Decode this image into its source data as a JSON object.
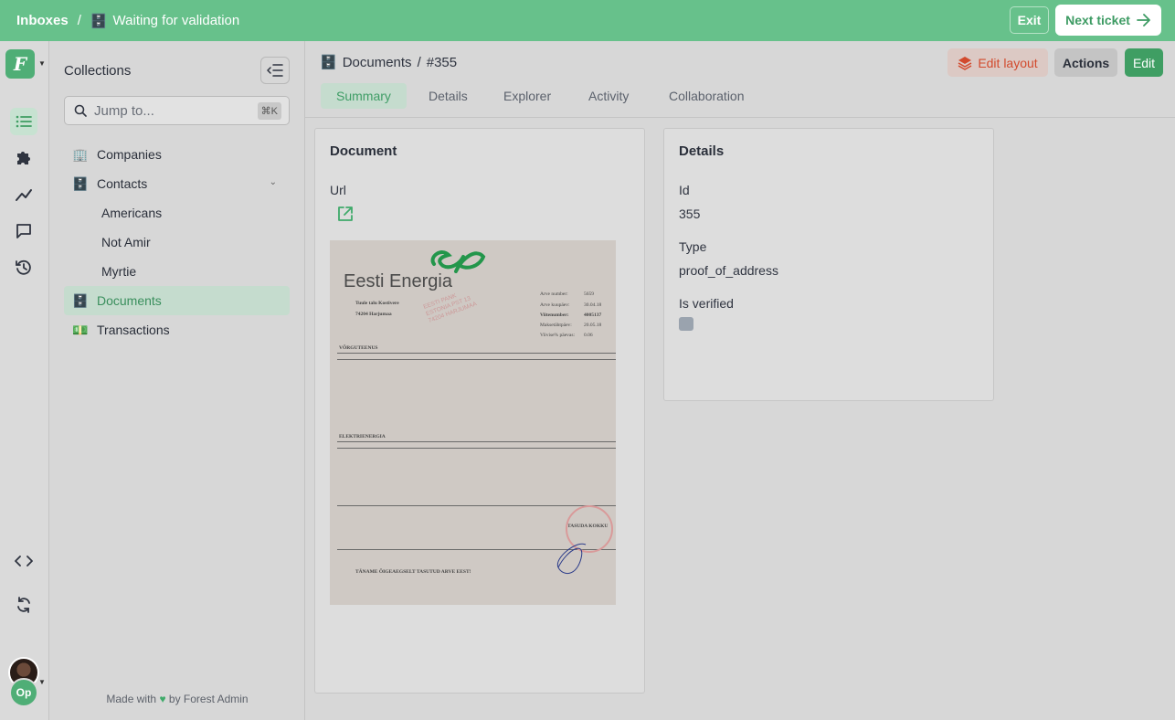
{
  "topbar": {
    "root": "Inboxes",
    "separator": "/",
    "current_icon": "🗄️",
    "current": "Waiting for validation",
    "exit_label": "Exit",
    "next_label": "Next ticket"
  },
  "rail": {
    "icons": [
      "list-icon",
      "puzzle-icon",
      "chart-line-icon",
      "chat-icon",
      "history-icon",
      "code-icon",
      "sync-icon"
    ],
    "user_initials": "Op"
  },
  "sidebar": {
    "title": "Collections",
    "search_placeholder": "Jump to...",
    "search_shortcut": "⌘K",
    "items": [
      {
        "icon": "🏢",
        "label": "Companies"
      },
      {
        "icon": "🗄️",
        "label": "Contacts"
      },
      {
        "label": "Americans"
      },
      {
        "label": "Not Amir"
      },
      {
        "label": "Myrtie"
      },
      {
        "icon": "🗄️",
        "label": "Documents"
      },
      {
        "icon": "💵",
        "label": "Transactions"
      }
    ],
    "footer_prefix": "Made with",
    "footer_suffix": "by Forest Admin"
  },
  "header": {
    "title_icon": "🗄️",
    "collection": "Documents",
    "separator": "/",
    "record": "#355",
    "tabs": [
      "Summary",
      "Details",
      "Explorer",
      "Activity",
      "Collaboration"
    ],
    "active_tab": "Summary",
    "edit_layout_label": "Edit layout",
    "actions_label": "Actions",
    "edit_label": "Edit"
  },
  "document_card": {
    "title": "Document",
    "url_label": "Url",
    "image": {
      "brand": "Eesti Energia",
      "customer_name": "Tuule talu Kostivere",
      "customer_address": "74204 Harjumaa",
      "meta": [
        {
          "label": "Arve number:",
          "value": "5659"
        },
        {
          "label": "Arve kuupäev:",
          "value": "30.04.18"
        },
        {
          "label": "Viitenumber:",
          "value": "4005137"
        },
        {
          "label": "Maksetähtpäev:",
          "value": "20.05.18"
        },
        {
          "label": "Viivise% päevas:",
          "value": "0.06"
        }
      ],
      "section1": "VÕRGUTEENUS",
      "section2": "ELEKTRIENERGIA",
      "total": "TASUDA KOKKU",
      "footer": "TÄNAME ÕIGEAEGSELT TASUTUD ARVE EEST!"
    }
  },
  "details_card": {
    "title": "Details",
    "id_label": "Id",
    "id_value": "355",
    "type_label": "Type",
    "type_value": "proof_of_address",
    "verified_label": "Is verified",
    "verified_value": false
  },
  "colors": {
    "brand_green": "#67c18b",
    "accent_green": "#3f9e63",
    "edit_layout_red": "#d24a2d"
  }
}
